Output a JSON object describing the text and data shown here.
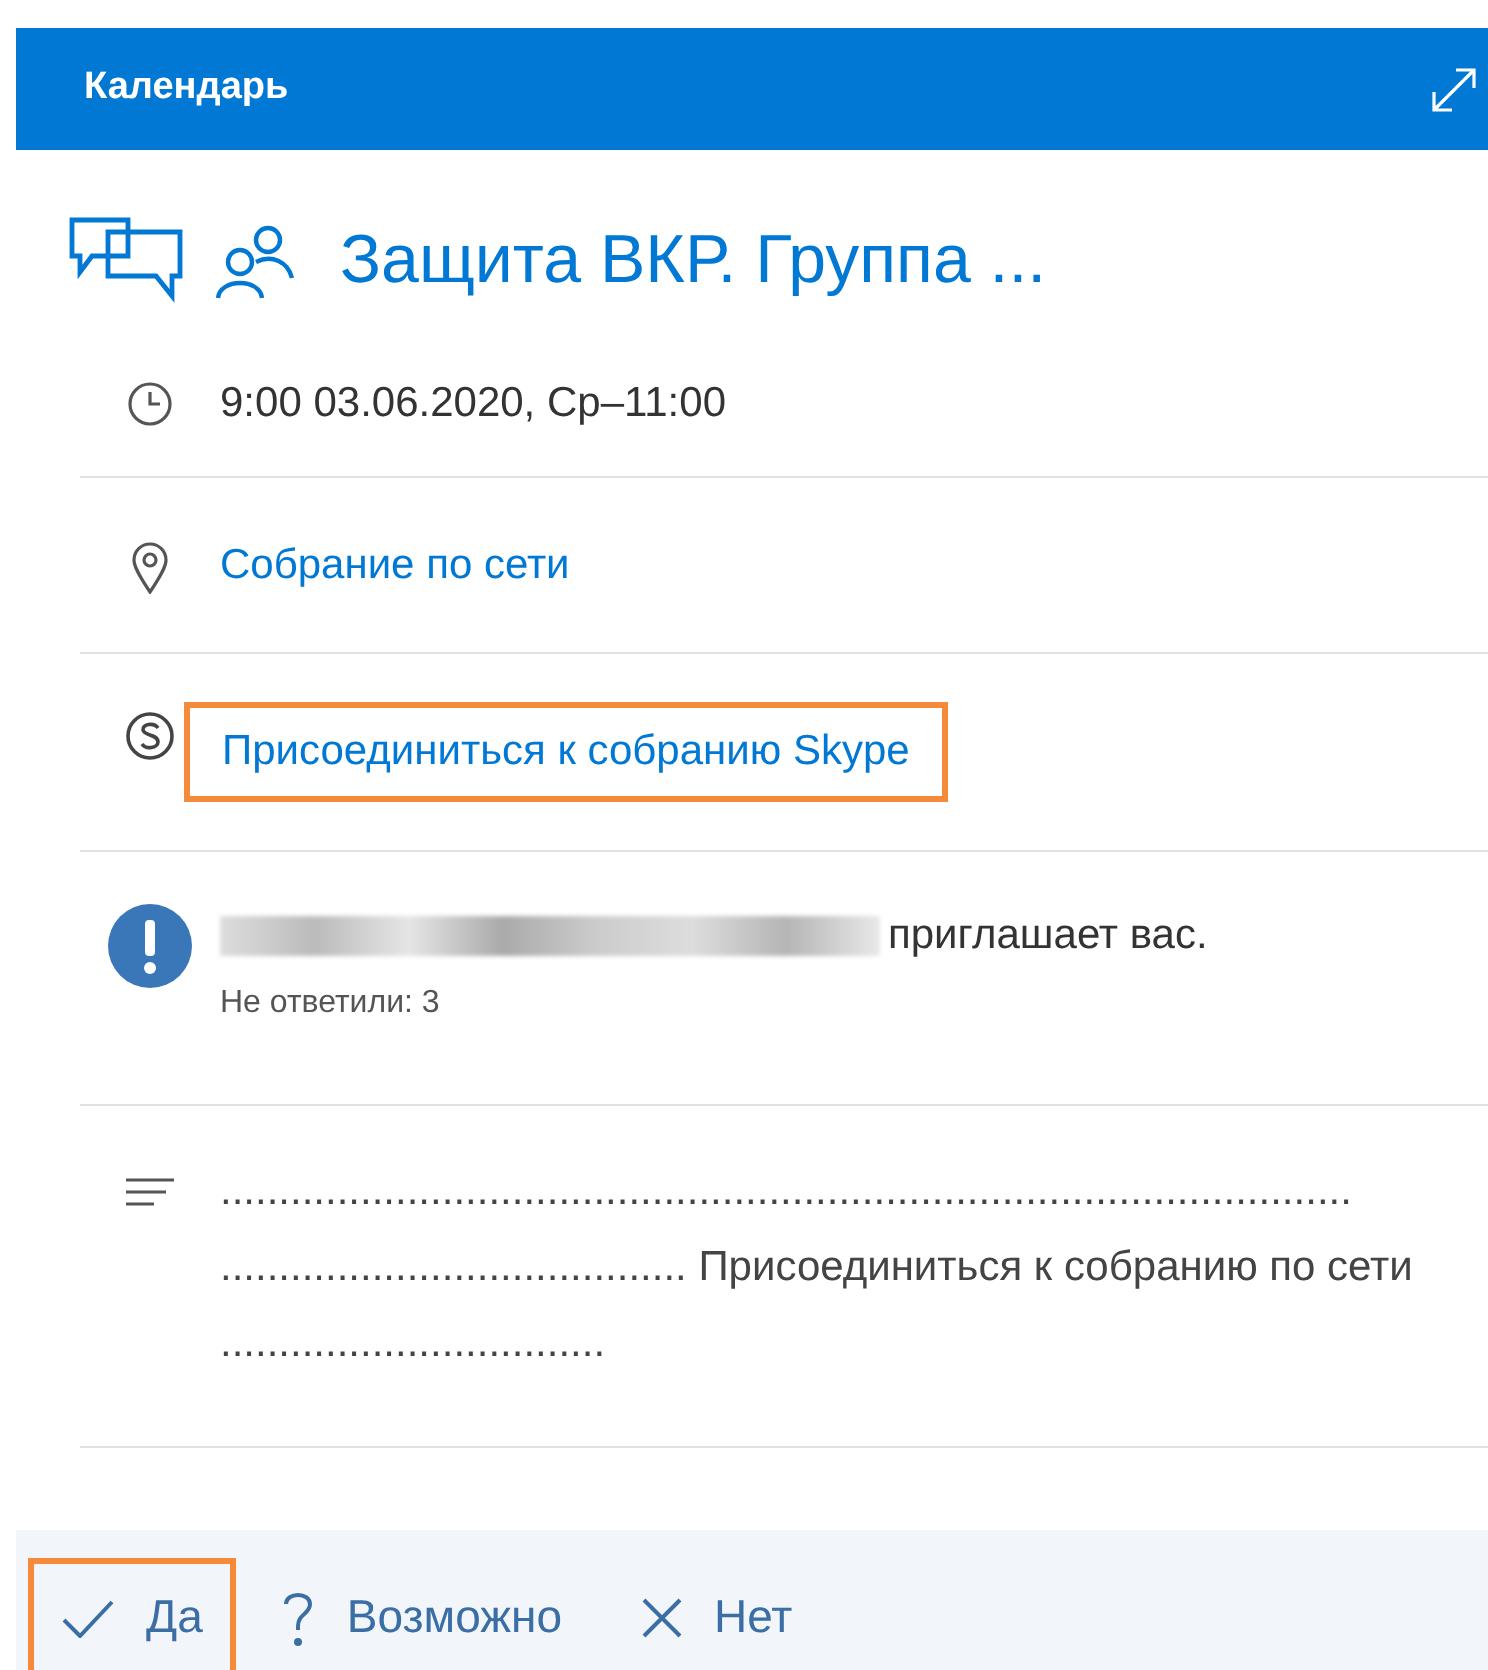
{
  "header": {
    "title": "Календарь"
  },
  "event": {
    "title": "Защита ВКР. Группа ...",
    "rows": [
      {
        "kind": "time",
        "text": "9:00 03.06.2020, Ср–11:00"
      },
      {
        "kind": "location",
        "text": "Собрание по сети"
      },
      {
        "kind": "skype",
        "text": "Присоединиться к собранию Skype",
        "highlighted": true
      },
      {
        "kind": "organizer",
        "text": "приглашает вас.",
        "note": "Не ответили: 3"
      },
      {
        "kind": "notes",
        "text": "................................................................................................. ........................................ Присоединиться к собранию по сети ................................."
      }
    ]
  },
  "responses": [
    {
      "kind": "yes",
      "label": "Да",
      "highlighted": true
    },
    {
      "kind": "maybe",
      "label": "Возможно",
      "highlighted": false
    },
    {
      "kind": "no",
      "label": "Нет",
      "highlighted": false
    }
  ]
}
